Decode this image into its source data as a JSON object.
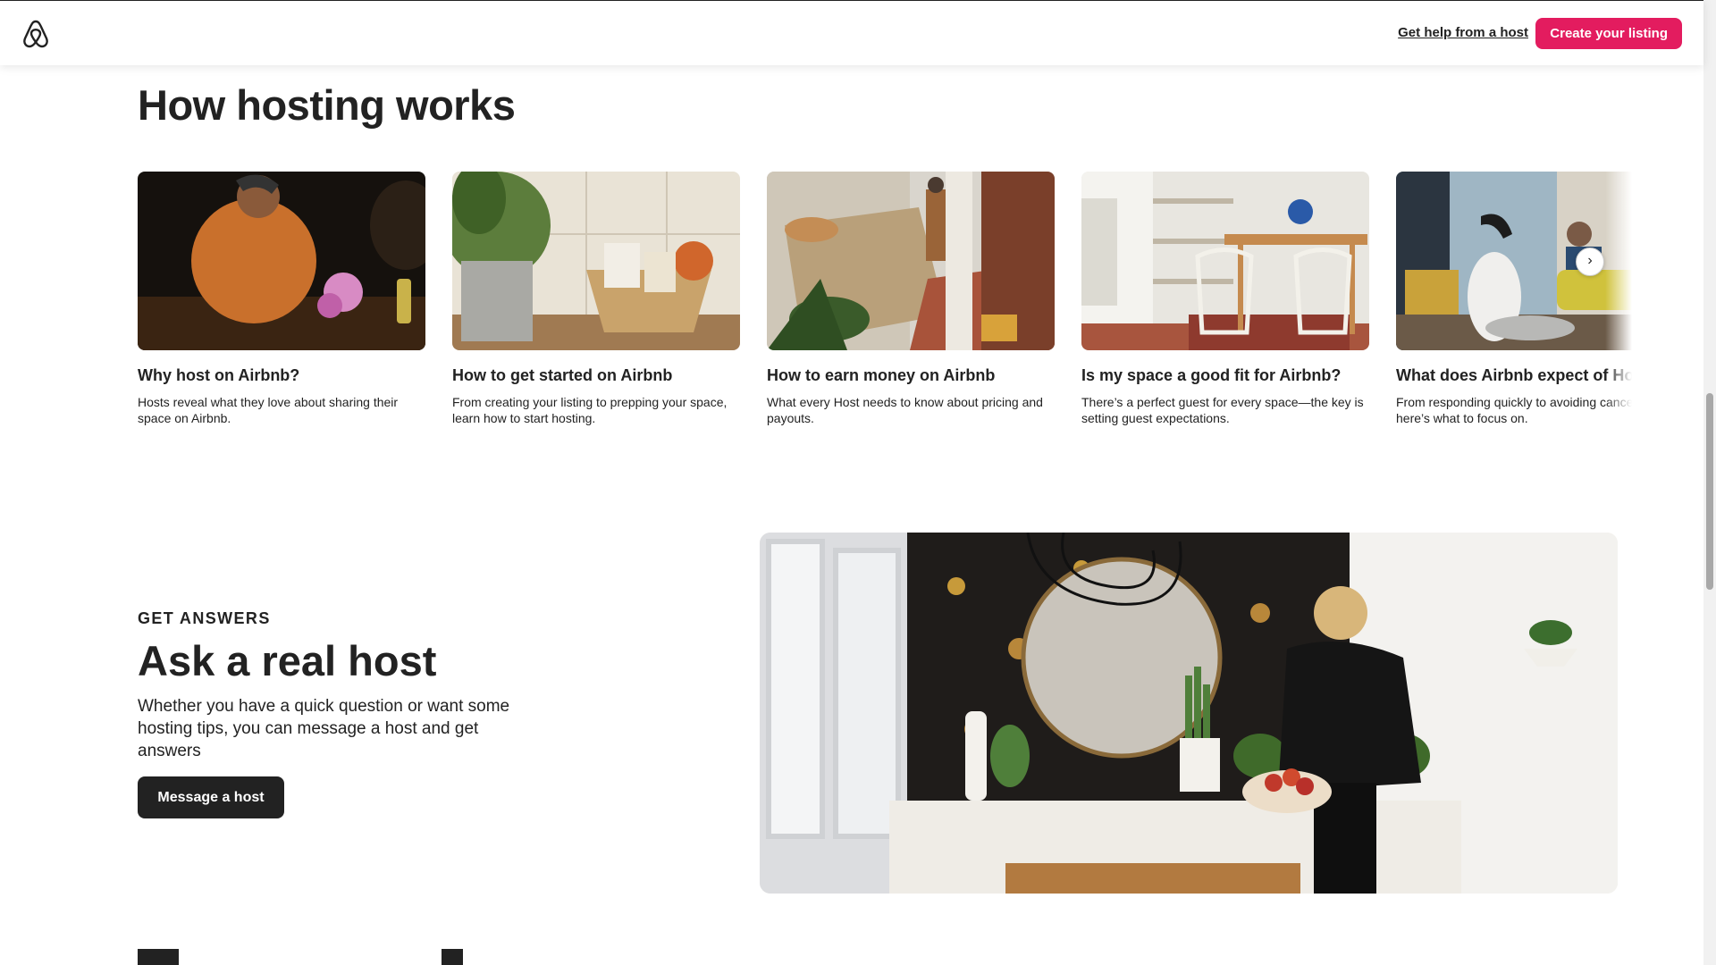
{
  "header": {
    "logo_icon": "airbnb-logo-icon",
    "help_link": "Get help from a host",
    "cta_button": "Create your listing",
    "accent_color": "#E31C5F"
  },
  "how_hosting": {
    "title": "How hosting works",
    "cards": [
      {
        "title": "Why host on Airbnb?",
        "description": "Hosts reveal what they love about sharing their space on Airbnb."
      },
      {
        "title": "How to get started on Airbnb",
        "description": "From creating your listing to prepping your space, learn how to start hosting."
      },
      {
        "title": "How to earn money on Airbnb",
        "description": "What every Host needs to know about pricing and payouts."
      },
      {
        "title": "Is my space a good fit for Airbnb?",
        "description": "There’s a perfect guest for every space—the key is setting guest expectations."
      },
      {
        "title": "What does Airbnb expect of Hosts?",
        "description": "From responding quickly to avoiding cancellations, here’s what to focus on."
      }
    ],
    "next_icon": "chevron-right-icon"
  },
  "ask_host": {
    "eyebrow": "GET ANSWERS",
    "title": "Ask a real host",
    "description": "Whether you have a quick question or want some hosting tips, you can message a host and get answers",
    "button": "Message a host"
  }
}
